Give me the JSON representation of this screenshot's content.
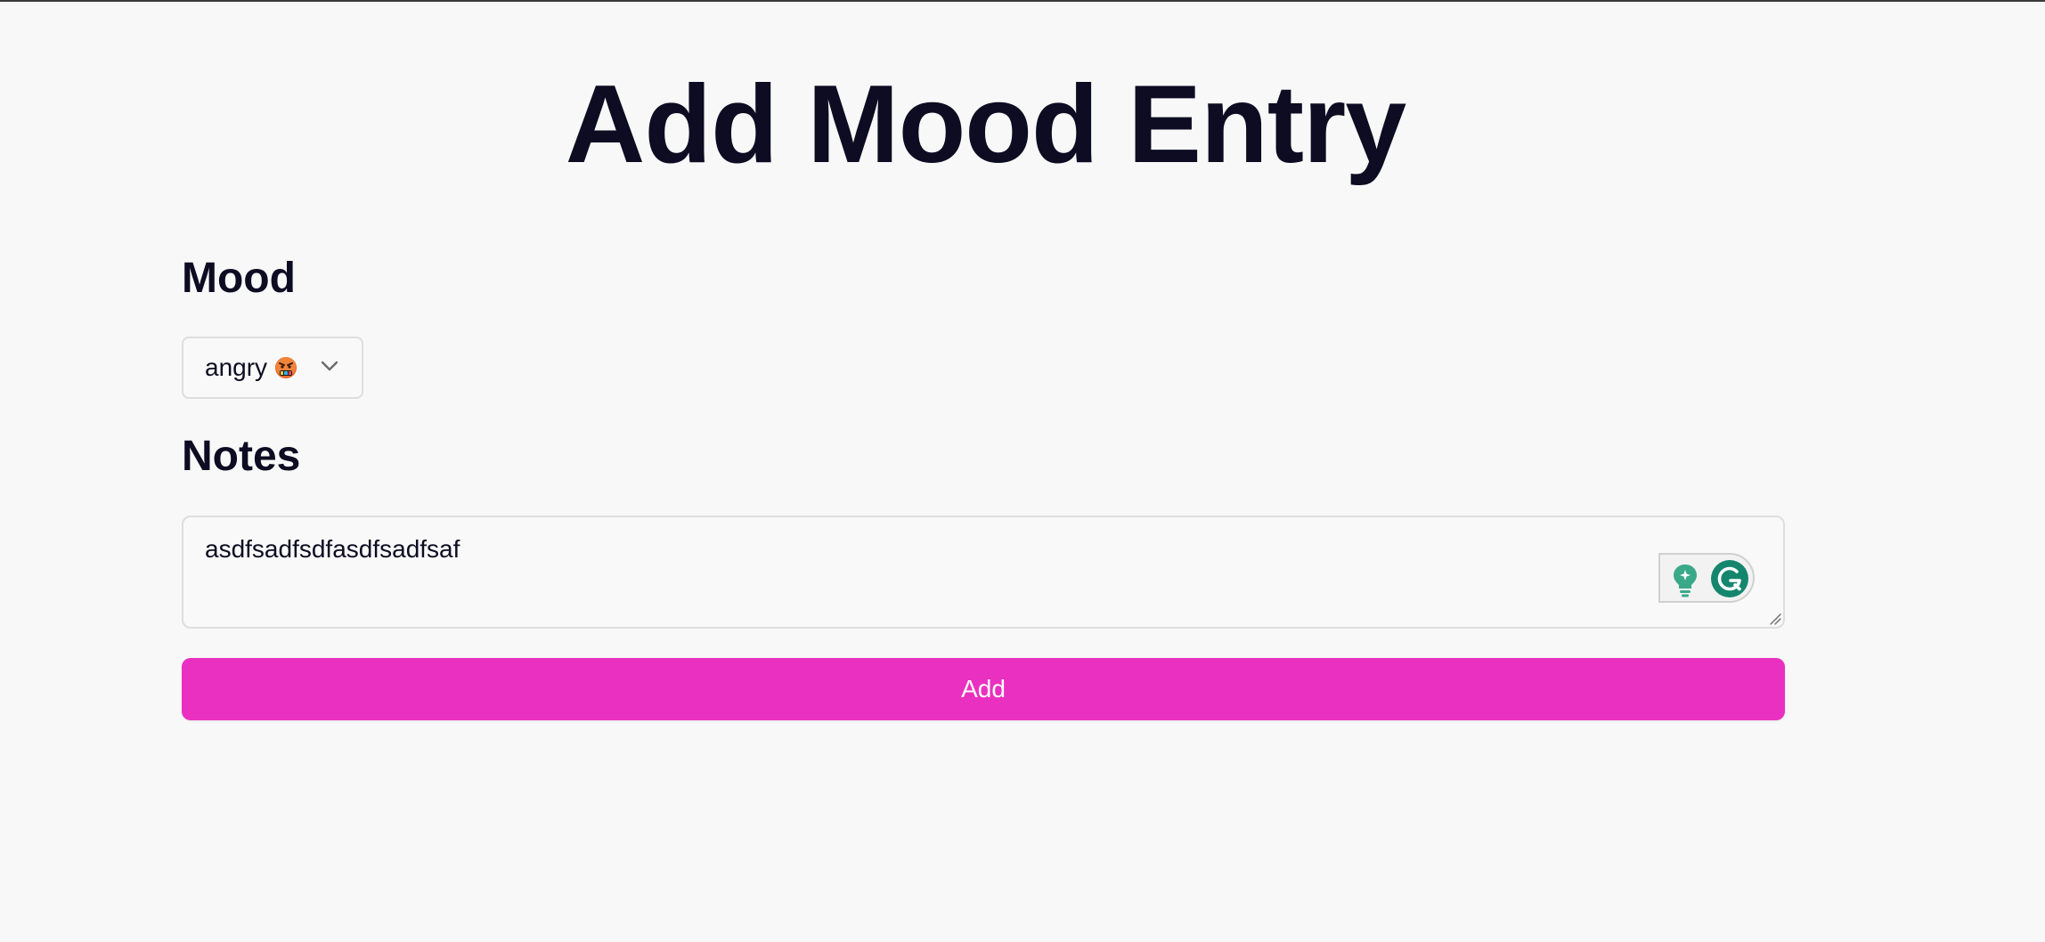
{
  "page": {
    "title": "Add Mood Entry"
  },
  "form": {
    "mood_label": "Mood",
    "mood_selected": "angry",
    "mood_emoji_icon": "angry-cursing-face-icon",
    "notes_label": "Notes",
    "notes_value": "asdfsadfsdfasdfsadfsaf",
    "submit_label": "Add"
  },
  "colors": {
    "background": "#f8f8f8",
    "text": "#0d0c22",
    "accent": "#ea30c0",
    "grammarly": "#15866e"
  },
  "icons": {
    "select_chevron": "chevron-down-icon",
    "textarea_resize": "resize-handle-icon",
    "assistant_bulb": "lightbulb-icon",
    "grammarly": "grammarly-icon"
  }
}
